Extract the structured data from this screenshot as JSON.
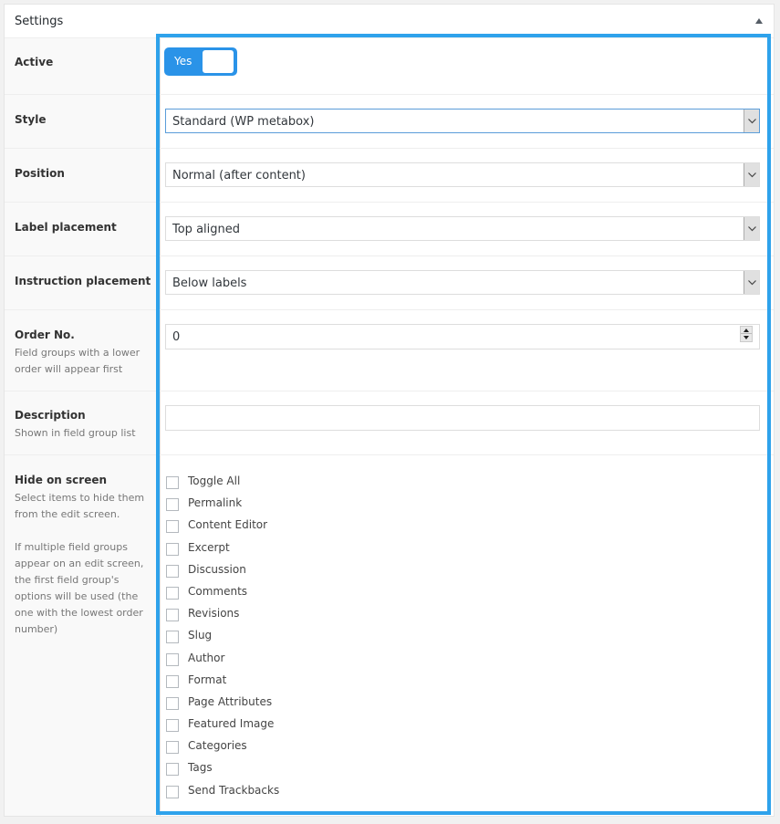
{
  "header": {
    "title": "Settings",
    "collapse_icon": "triangle-up-icon"
  },
  "colors": {
    "accent": "#2ea2eb",
    "switch": "#2a93e8"
  },
  "fields": {
    "active": {
      "label": "Active",
      "switch_text": "Yes",
      "value": true
    },
    "style": {
      "label": "Style",
      "value": "Standard (WP metabox)"
    },
    "position": {
      "label": "Position",
      "value": "Normal (after content)"
    },
    "label_placement": {
      "label": "Label placement",
      "value": "Top aligned"
    },
    "instruction_placement": {
      "label": "Instruction placement",
      "value": "Below labels"
    },
    "order_no": {
      "label": "Order No.",
      "description": "Field groups with a lower order will appear first",
      "value": "0"
    },
    "description": {
      "label": "Description",
      "description": "Shown in field group list",
      "value": ""
    },
    "hide_on_screen": {
      "label": "Hide on screen",
      "description_1": "Select items to hide them from the edit screen.",
      "description_2": "If multiple field groups appear on an edit screen, the first field group's options will be used (the one with the lowest order number)",
      "items": [
        {
          "label": "Toggle All",
          "checked": false
        },
        {
          "label": "Permalink",
          "checked": false
        },
        {
          "label": "Content Editor",
          "checked": false
        },
        {
          "label": "Excerpt",
          "checked": false
        },
        {
          "label": "Discussion",
          "checked": false
        },
        {
          "label": "Comments",
          "checked": false
        },
        {
          "label": "Revisions",
          "checked": false
        },
        {
          "label": "Slug",
          "checked": false
        },
        {
          "label": "Author",
          "checked": false
        },
        {
          "label": "Format",
          "checked": false
        },
        {
          "label": "Page Attributes",
          "checked": false
        },
        {
          "label": "Featured Image",
          "checked": false
        },
        {
          "label": "Categories",
          "checked": false
        },
        {
          "label": "Tags",
          "checked": false
        },
        {
          "label": "Send Trackbacks",
          "checked": false
        }
      ]
    }
  }
}
